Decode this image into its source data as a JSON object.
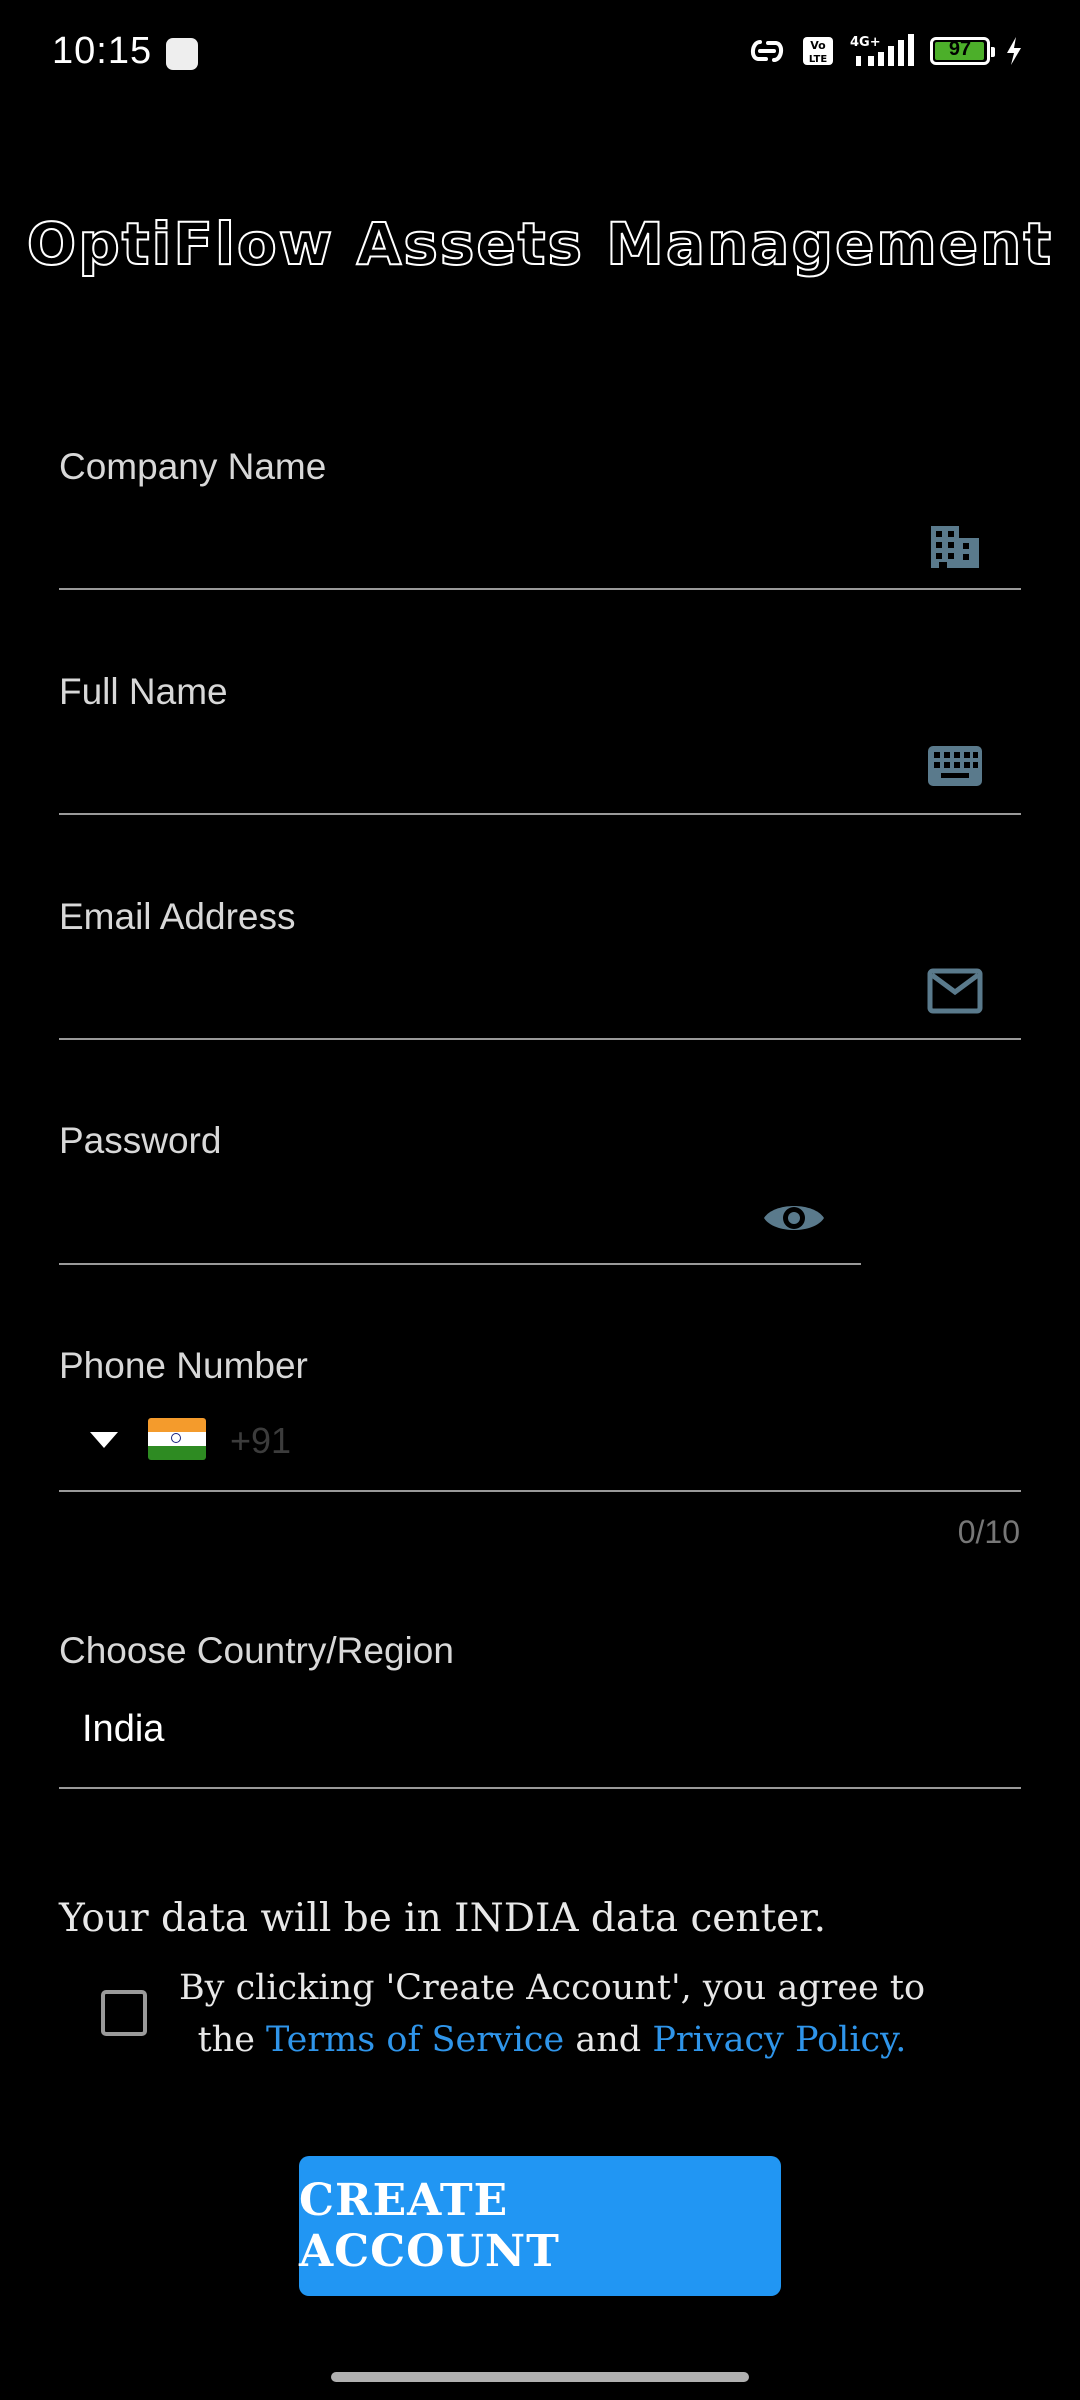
{
  "status_bar": {
    "time": "10:15",
    "network": "4G+",
    "volte": "Vo LTE",
    "battery_level": "97",
    "battery_fraction": 0.97
  },
  "app": {
    "title": "OptiFlow Assets Management"
  },
  "form": {
    "company_name": {
      "label": "Company Name",
      "value": "",
      "icon": "building-icon"
    },
    "full_name": {
      "label": "Full Name",
      "value": "",
      "icon": "keyboard-icon"
    },
    "email": {
      "label": "Email Address",
      "value": "",
      "icon": "mail-icon"
    },
    "password": {
      "label": "Password",
      "value": "",
      "icon": "eye-icon"
    },
    "phone": {
      "label": "Phone Number",
      "placeholder": "+91",
      "counter": "0/10",
      "flag": "india-flag-icon"
    },
    "country": {
      "label": "Choose Country/Region",
      "value": "India"
    }
  },
  "datacenter_note": "Your data will be in INDIA data center.",
  "agreement": {
    "checked": false,
    "text_before": "By clicking 'Create Account', you agree to the ",
    "terms_link": "Terms of Service",
    "text_middle": " and ",
    "privacy_link": "Privacy Policy."
  },
  "create_button_label": "CREATE ACCOUNT",
  "colors": {
    "background": "#000000",
    "accent": "#2196f3",
    "link": "#2f95ea",
    "icon": "#5a7a8c"
  }
}
